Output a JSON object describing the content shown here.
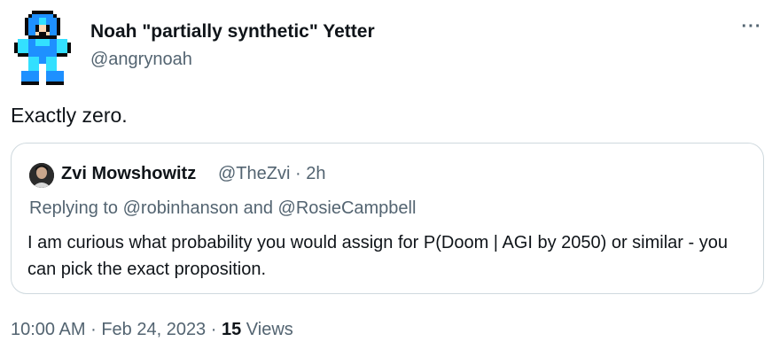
{
  "tweet": {
    "author_name": "Noah \"partially synthetic\" Yetter",
    "author_handle": "@angrynoah",
    "more_icon": "more-horizontal-icon",
    "text": "Exactly zero.",
    "quoted": {
      "author_name": "Zvi Mowshowitz",
      "author_handle": "@TheZvi",
      "separator": "·",
      "time_ago": "2h",
      "replying_prefix": "Replying to",
      "replying_to_1": "@robinhanson",
      "replying_joiner": "and",
      "replying_to_2": "@RosieCampbell",
      "text": "I am curious what probability you would assign for P(Doom | AGI by 2050) or similar - you can pick the exact proposition."
    },
    "time": "10:00 AM",
    "date": "Feb 24, 2023",
    "views_count": "15",
    "views_label": "Views",
    "meta_separator": "·"
  },
  "colors": {
    "text_primary": "#0f1419",
    "text_secondary": "#536471",
    "border": "#cfd9de",
    "avatar_blue": "#1e90ff",
    "avatar_cyan": "#33e0ff"
  }
}
